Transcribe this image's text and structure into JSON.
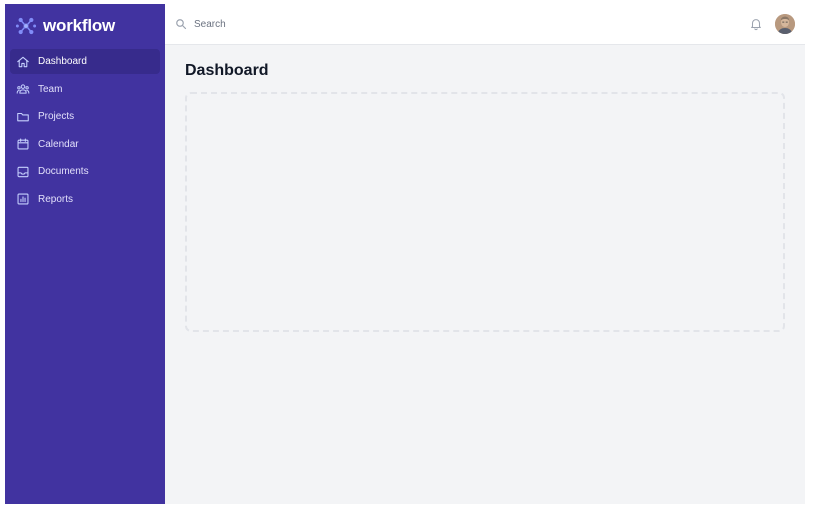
{
  "brand": {
    "name": "workflow",
    "logo_icon": "workflow-logo-icon",
    "accent": "#818cf8"
  },
  "sidebar": {
    "background": "#4133a0",
    "items": [
      {
        "label": "Dashboard",
        "icon": "home-icon",
        "active": true
      },
      {
        "label": "Team",
        "icon": "users-icon",
        "active": false
      },
      {
        "label": "Projects",
        "icon": "folder-icon",
        "active": false
      },
      {
        "label": "Calendar",
        "icon": "calendar-icon",
        "active": false
      },
      {
        "label": "Documents",
        "icon": "inbox-icon",
        "active": false
      },
      {
        "label": "Reports",
        "icon": "chart-bar-icon",
        "active": false
      }
    ]
  },
  "topbar": {
    "search": {
      "placeholder": "Search",
      "value": ""
    },
    "notifications_icon": "bell-icon",
    "avatar_icon": "user-avatar"
  },
  "main": {
    "title": "Dashboard"
  }
}
